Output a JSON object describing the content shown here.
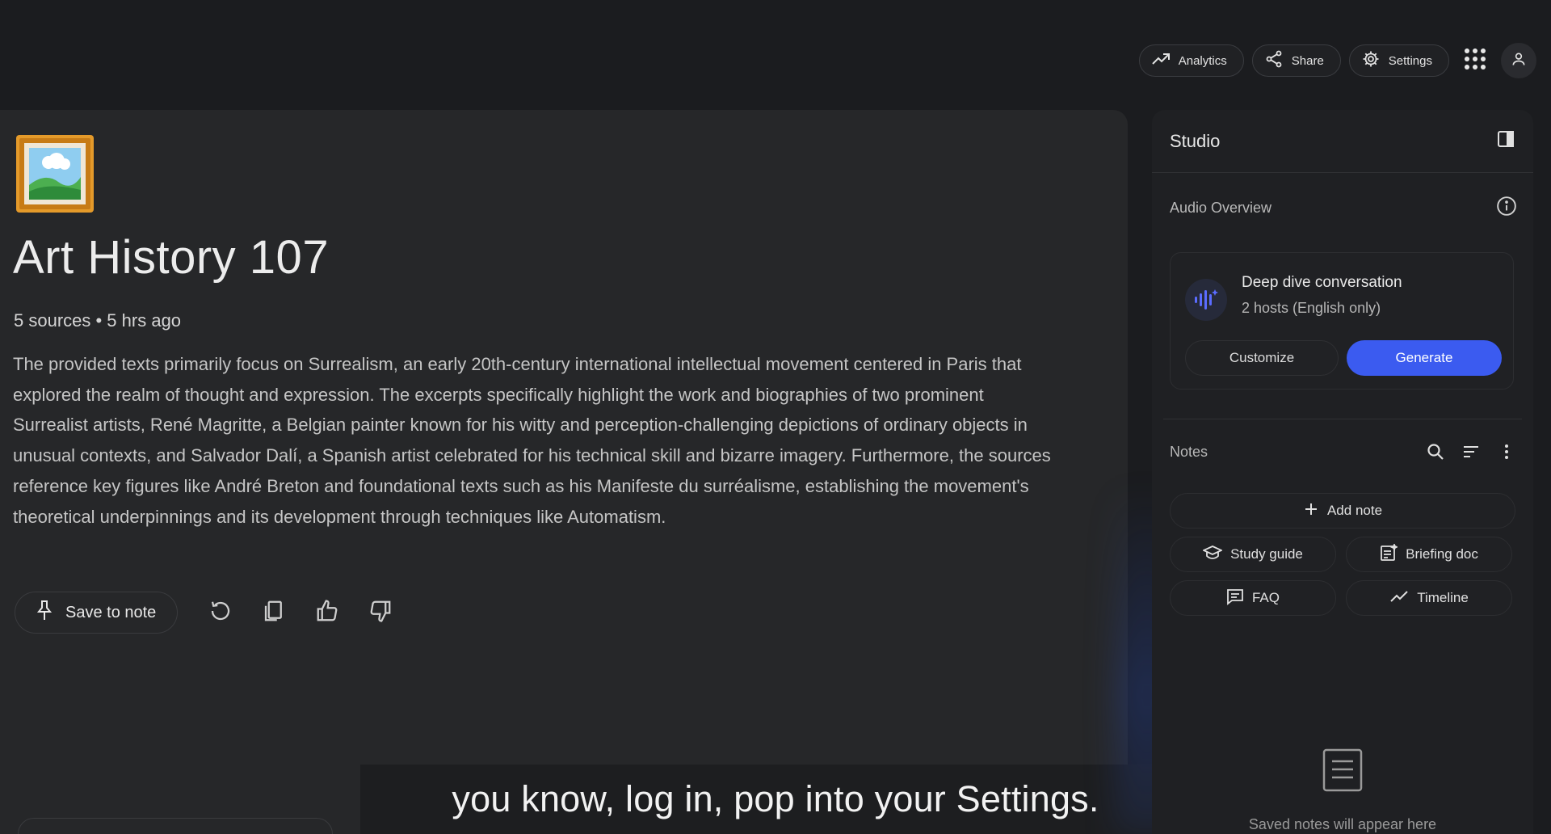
{
  "topbar": {
    "analytics_label": "Analytics",
    "share_label": "Share",
    "settings_label": "Settings"
  },
  "notebook": {
    "title": "Art History 107",
    "meta": "5 sources • 5 hrs ago",
    "summary": "The provided texts primarily focus on Surrealism, an early 20th-century international intellectual movement centered in Paris that explored the realm of thought and expression. The excerpts specifically highlight the work and biographies of two prominent Surrealist artists, René Magritte, a Belgian painter known for his witty and perception-challenging depictions of ordinary objects in unusual contexts, and Salvador Dalí, a Spanish artist celebrated for his technical skill and bizarre imagery. Furthermore, the sources reference key figures like André Breton and foundational texts such as his Manifeste du surréalisme, establishing the movement's theoretical underpinnings and its development through techniques like Automatism.",
    "save_to_note_label": "Save to note"
  },
  "caption": "you know, log in, pop into your Settings.",
  "studio": {
    "title": "Studio",
    "audio_overview_label": "Audio Overview",
    "audio_card": {
      "title": "Deep dive conversation",
      "subtitle": "2 hosts (English only)",
      "customize_label": "Customize",
      "generate_label": "Generate"
    },
    "notes_label": "Notes",
    "add_note_label": "Add note",
    "chips": [
      {
        "label": "Study guide",
        "icon": "graduation-cap-icon"
      },
      {
        "label": "Briefing doc",
        "icon": "briefing-doc-icon"
      },
      {
        "label": "FAQ",
        "icon": "faq-icon"
      },
      {
        "label": "Timeline",
        "icon": "timeline-icon"
      }
    ],
    "empty_notes_text": "Saved notes will appear here"
  },
  "colors": {
    "accent": "#3b5bf0",
    "background": "#1b1c1f",
    "panel": "#262729",
    "studio_panel": "#1f2023"
  }
}
